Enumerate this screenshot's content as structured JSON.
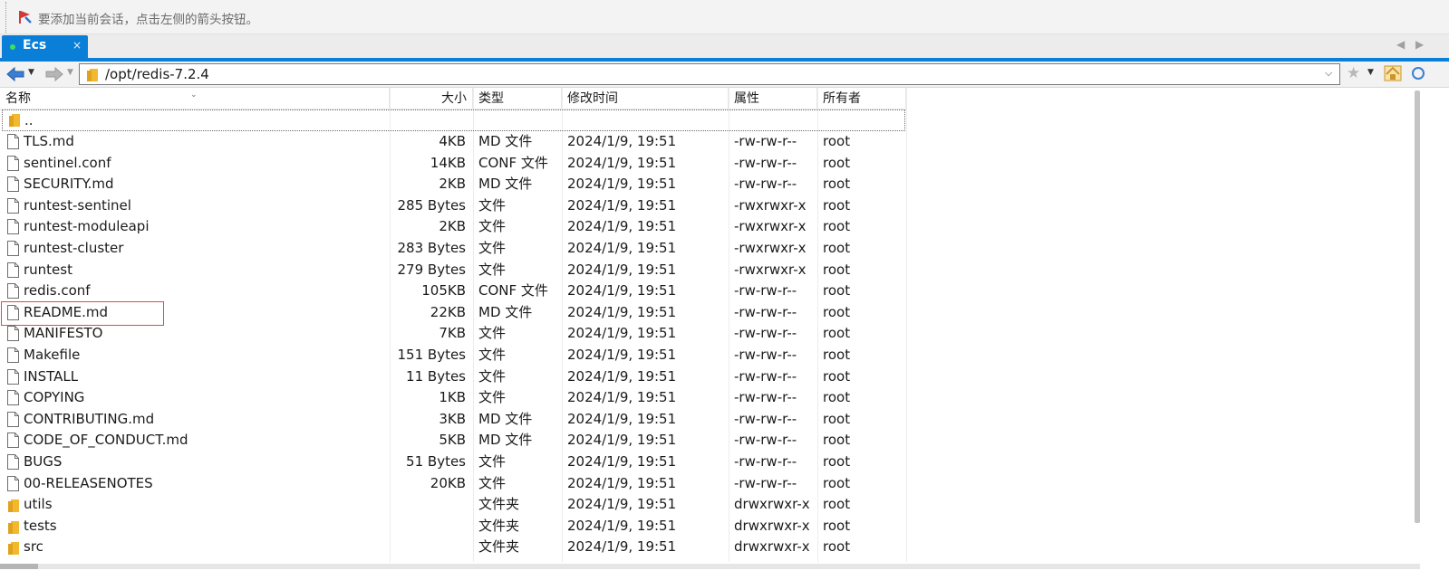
{
  "hint": {
    "text": "要添加当前会话，点击左侧的箭头按钮。"
  },
  "tab": {
    "label": "Ecs",
    "close": "×"
  },
  "path": {
    "value": "/opt/redis-7.2.4"
  },
  "columns": {
    "name": "名称",
    "size": "大小",
    "type": "类型",
    "mtime": "修改时间",
    "attr": "属性",
    "owner": "所有者"
  },
  "parent_dir": "..",
  "files": [
    {
      "name": "TLS.md",
      "size": "4KB",
      "type": "MD 文件",
      "mtime": "2024/1/9, 19:51",
      "attr": "-rw-rw-r--",
      "owner": "root",
      "kind": "file"
    },
    {
      "name": "sentinel.conf",
      "size": "14KB",
      "type": "CONF 文件",
      "mtime": "2024/1/9, 19:51",
      "attr": "-rw-rw-r--",
      "owner": "root",
      "kind": "file"
    },
    {
      "name": "SECURITY.md",
      "size": "2KB",
      "type": "MD 文件",
      "mtime": "2024/1/9, 19:51",
      "attr": "-rw-rw-r--",
      "owner": "root",
      "kind": "file"
    },
    {
      "name": "runtest-sentinel",
      "size": "285 Bytes",
      "type": "文件",
      "mtime": "2024/1/9, 19:51",
      "attr": "-rwxrwxr-x",
      "owner": "root",
      "kind": "file"
    },
    {
      "name": "runtest-moduleapi",
      "size": "2KB",
      "type": "文件",
      "mtime": "2024/1/9, 19:51",
      "attr": "-rwxrwxr-x",
      "owner": "root",
      "kind": "file"
    },
    {
      "name": "runtest-cluster",
      "size": "283 Bytes",
      "type": "文件",
      "mtime": "2024/1/9, 19:51",
      "attr": "-rwxrwxr-x",
      "owner": "root",
      "kind": "file"
    },
    {
      "name": "runtest",
      "size": "279 Bytes",
      "type": "文件",
      "mtime": "2024/1/9, 19:51",
      "attr": "-rwxrwxr-x",
      "owner": "root",
      "kind": "file"
    },
    {
      "name": "redis.conf",
      "size": "105KB",
      "type": "CONF 文件",
      "mtime": "2024/1/9, 19:51",
      "attr": "-rw-rw-r--",
      "owner": "root",
      "kind": "file"
    },
    {
      "name": "README.md",
      "size": "22KB",
      "type": "MD 文件",
      "mtime": "2024/1/9, 19:51",
      "attr": "-rw-rw-r--",
      "owner": "root",
      "kind": "file"
    },
    {
      "name": "MANIFESTO",
      "size": "7KB",
      "type": "文件",
      "mtime": "2024/1/9, 19:51",
      "attr": "-rw-rw-r--",
      "owner": "root",
      "kind": "file"
    },
    {
      "name": "Makefile",
      "size": "151 Bytes",
      "type": "文件",
      "mtime": "2024/1/9, 19:51",
      "attr": "-rw-rw-r--",
      "owner": "root",
      "kind": "file"
    },
    {
      "name": "INSTALL",
      "size": "11 Bytes",
      "type": "文件",
      "mtime": "2024/1/9, 19:51",
      "attr": "-rw-rw-r--",
      "owner": "root",
      "kind": "file"
    },
    {
      "name": "COPYING",
      "size": "1KB",
      "type": "文件",
      "mtime": "2024/1/9, 19:51",
      "attr": "-rw-rw-r--",
      "owner": "root",
      "kind": "file"
    },
    {
      "name": "CONTRIBUTING.md",
      "size": "3KB",
      "type": "MD 文件",
      "mtime": "2024/1/9, 19:51",
      "attr": "-rw-rw-r--",
      "owner": "root",
      "kind": "file"
    },
    {
      "name": "CODE_OF_CONDUCT.md",
      "size": "5KB",
      "type": "MD 文件",
      "mtime": "2024/1/9, 19:51",
      "attr": "-rw-rw-r--",
      "owner": "root",
      "kind": "file"
    },
    {
      "name": "BUGS",
      "size": "51 Bytes",
      "type": "文件",
      "mtime": "2024/1/9, 19:51",
      "attr": "-rw-rw-r--",
      "owner": "root",
      "kind": "file"
    },
    {
      "name": "00-RELEASENOTES",
      "size": "20KB",
      "type": "文件",
      "mtime": "2024/1/9, 19:51",
      "attr": "-rw-rw-r--",
      "owner": "root",
      "kind": "file"
    },
    {
      "name": "utils",
      "size": "",
      "type": "文件夹",
      "mtime": "2024/1/9, 19:51",
      "attr": "drwxrwxr-x",
      "owner": "root",
      "kind": "folder"
    },
    {
      "name": "tests",
      "size": "",
      "type": "文件夹",
      "mtime": "2024/1/9, 19:51",
      "attr": "drwxrwxr-x",
      "owner": "root",
      "kind": "folder"
    },
    {
      "name": "src",
      "size": "",
      "type": "文件夹",
      "mtime": "2024/1/9, 19:51",
      "attr": "drwxrwxr-x",
      "owner": "root",
      "kind": "folder"
    }
  ],
  "highlighted_file": "README.md",
  "colors": {
    "accent": "#0a7fd8",
    "highlight_border": "#e04a4a",
    "folder": "#f2b830"
  },
  "icons": {
    "flag": "flag-icon",
    "back": "arrow-left-icon",
    "forward": "arrow-right-icon",
    "folder": "folder-icon",
    "file": "file-icon",
    "star": "star-icon",
    "home": "home-icon",
    "refresh": "refresh-icon"
  }
}
